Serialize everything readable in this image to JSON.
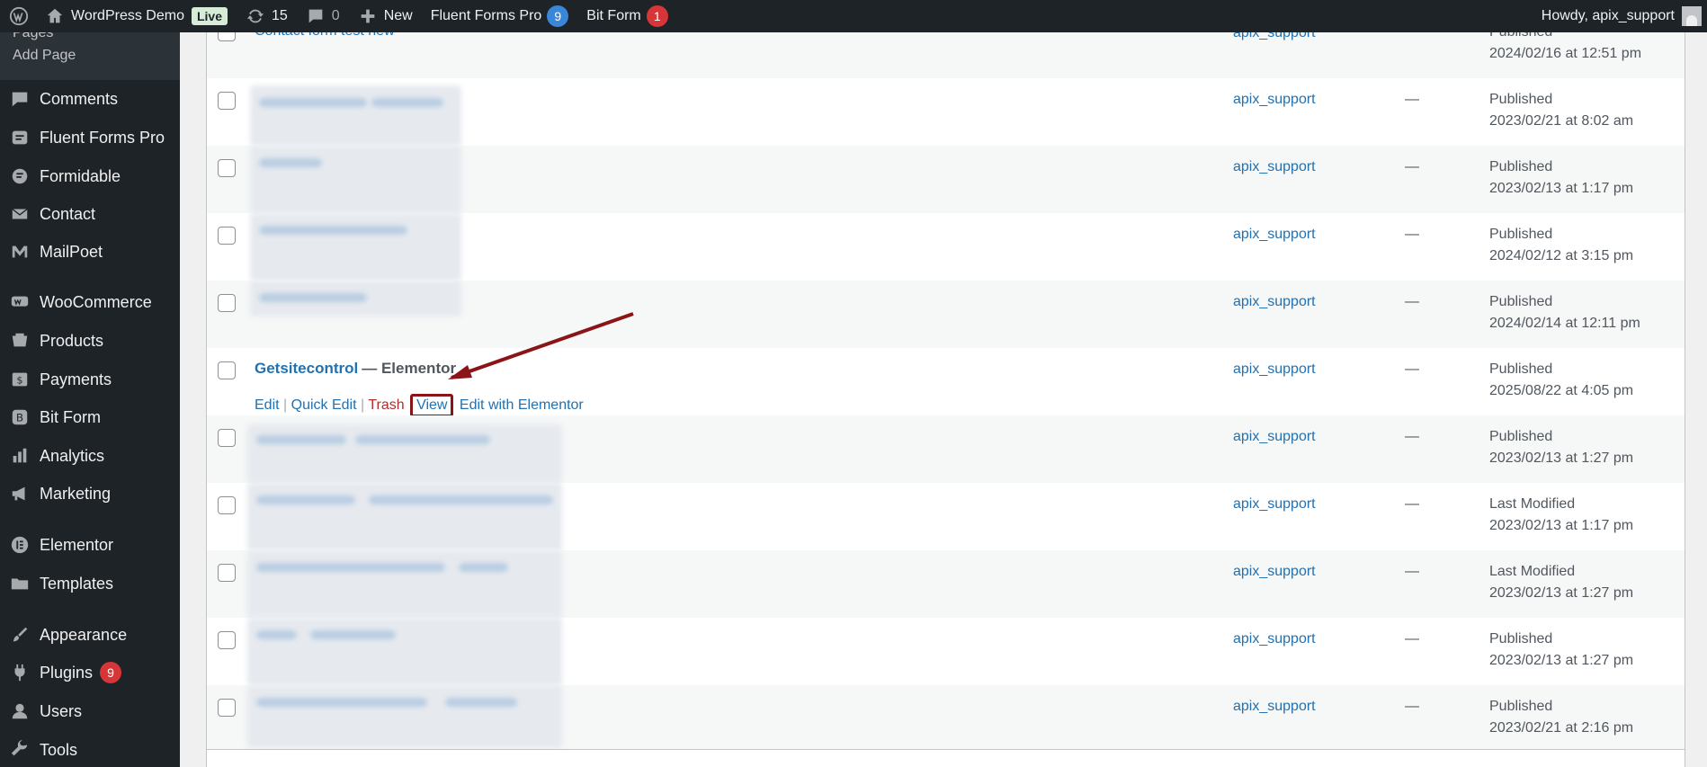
{
  "adminbar": {
    "site_name": "WordPress Demo",
    "live_label": "Live",
    "updates_count": "15",
    "comments_count": "0",
    "new_label": "New",
    "fluent_label": "Fluent Forms Pro",
    "fluent_count": "9",
    "bitform_label": "Bit Form",
    "bitform_count": "1",
    "howdy": "Howdy, apix_support"
  },
  "sidebar": {
    "submenu": {
      "hidden_label": "Pages",
      "add_page": "Add Page"
    },
    "items": [
      {
        "label": "Comments",
        "icon": "comment-icon"
      },
      {
        "label": "Fluent Forms Pro",
        "icon": "fluent-forms-icon"
      },
      {
        "label": "Formidable",
        "icon": "formidable-icon"
      },
      {
        "label": "Contact",
        "icon": "envelope-icon"
      },
      {
        "label": "MailPoet",
        "icon": "mailpoet-icon"
      },
      {
        "label": "WooCommerce",
        "icon": "woocommerce-icon"
      },
      {
        "label": "Products",
        "icon": "products-icon"
      },
      {
        "label": "Payments",
        "icon": "payments-icon"
      },
      {
        "label": "Bit Form",
        "icon": "bitform-icon"
      },
      {
        "label": "Analytics",
        "icon": "analytics-icon"
      },
      {
        "label": "Marketing",
        "icon": "megaphone-icon"
      },
      {
        "label": "Elementor",
        "icon": "elementor-icon"
      },
      {
        "label": "Templates",
        "icon": "folder-icon"
      },
      {
        "label": "Appearance",
        "icon": "brush-icon"
      },
      {
        "label": "Plugins",
        "icon": "plugin-icon",
        "badge": "9"
      },
      {
        "label": "Users",
        "icon": "user-icon"
      },
      {
        "label": "Tools",
        "icon": "wrench-icon"
      }
    ]
  },
  "table": {
    "rows": [
      {
        "title": "Contact form test new",
        "author": "apix_support",
        "status": "Published",
        "date": "2024/02/16 at 12:51 pm"
      },
      {
        "author": "apix_support",
        "status": "Published",
        "date": "2023/02/21 at 8:02 am"
      },
      {
        "author": "apix_support",
        "status": "Published",
        "date": "2023/02/13 at 1:17 pm"
      },
      {
        "author": "apix_support",
        "status": "Published",
        "date": "2024/02/12 at 3:15 pm"
      },
      {
        "author": "apix_support",
        "status": "Published",
        "date": "2024/02/14 at 12:11 pm"
      },
      {
        "title": "Getsitecontrol",
        "title_suffix": "— Elementor",
        "author": "apix_support",
        "status": "Published",
        "date": "2025/08/22 at 4:05 pm",
        "actions": {
          "edit": "Edit",
          "quick_edit": "Quick Edit",
          "trash": "Trash",
          "view": "View",
          "edit_elementor": "Edit with Elementor"
        }
      },
      {
        "author": "apix_support",
        "status": "Published",
        "date": "2023/02/13 at 1:27 pm"
      },
      {
        "author": "apix_support",
        "status": "Last Modified",
        "date": "2023/02/13 at 1:17 pm"
      },
      {
        "author": "apix_support",
        "status": "Last Modified",
        "date": "2023/02/13 at 1:27 pm"
      },
      {
        "author": "apix_support",
        "status": "Published",
        "date": "2023/02/13 at 1:27 pm"
      },
      {
        "author": "apix_support",
        "status": "Published",
        "date": "2023/02/21 at 2:16 pm"
      }
    ],
    "dash": "—"
  },
  "annotation": {
    "color": "#8b1418"
  }
}
